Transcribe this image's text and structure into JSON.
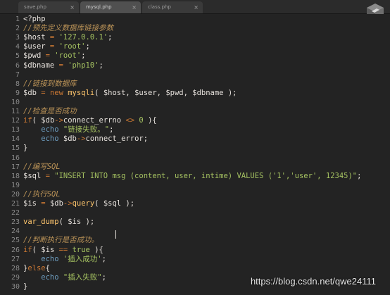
{
  "tabs": [
    {
      "label": "save.php"
    },
    {
      "label": "mysql.php"
    },
    {
      "label": "class.php"
    }
  ],
  "code_lines": [
    [
      [
        "<?php",
        "p"
      ]
    ],
    [
      [
        "//预先定义数据库链接参数",
        "c"
      ]
    ],
    [
      [
        "$host",
        "v"
      ],
      [
        " = ",
        "k"
      ],
      [
        "'127.0.0.1'",
        "s"
      ],
      [
        ";",
        "p"
      ]
    ],
    [
      [
        "$user",
        "v"
      ],
      [
        " = ",
        "k"
      ],
      [
        "'root'",
        "s"
      ],
      [
        ";",
        "p"
      ]
    ],
    [
      [
        "$pwd",
        "v"
      ],
      [
        " = ",
        "k"
      ],
      [
        "'root'",
        "s"
      ],
      [
        ";",
        "p"
      ]
    ],
    [
      [
        "$dbname",
        "v"
      ],
      [
        " = ",
        "k"
      ],
      [
        "'php10'",
        "s"
      ],
      [
        ";",
        "p"
      ]
    ],
    [],
    [
      [
        "//链接到数据库",
        "c"
      ]
    ],
    [
      [
        "$db",
        "v"
      ],
      [
        " = ",
        "k"
      ],
      [
        "new ",
        "k"
      ],
      [
        "mysqli",
        "f"
      ],
      [
        "( $host, $user, $pwd, $dbname );",
        "p"
      ]
    ],
    [],
    [
      [
        "//检查是否成功",
        "c"
      ]
    ],
    [
      [
        "if",
        "k"
      ],
      [
        "( $db",
        "p"
      ],
      [
        "->",
        "k"
      ],
      [
        "connect_errno ",
        "p"
      ],
      [
        "<>",
        "k"
      ],
      [
        " 0 ",
        "n"
      ],
      [
        "){",
        "p"
      ]
    ],
    [
      [
        "    echo ",
        "t"
      ],
      [
        "\"链接失败。\"",
        "s"
      ],
      [
        ";",
        "p"
      ]
    ],
    [
      [
        "    echo ",
        "t"
      ],
      [
        "$db",
        "p"
      ],
      [
        "->",
        "k"
      ],
      [
        "connect_error;",
        "p"
      ]
    ],
    [
      [
        "}",
        "p"
      ]
    ],
    [],
    [
      [
        "//编写SQL",
        "c"
      ]
    ],
    [
      [
        "$sql",
        "v"
      ],
      [
        " = ",
        "k"
      ],
      [
        "\"INSERT INTO msg (content, user, intime) VALUES ('1','user', 12345)\"",
        "s"
      ],
      [
        ";",
        "p"
      ]
    ],
    [],
    [
      [
        "//执行SQL",
        "c"
      ]
    ],
    [
      [
        "$is",
        "v"
      ],
      [
        " = ",
        "k"
      ],
      [
        "$db",
        "p"
      ],
      [
        "->",
        "k"
      ],
      [
        "query",
        "f"
      ],
      [
        "( $sql );",
        "p"
      ]
    ],
    [],
    [
      [
        "var_dump",
        "f"
      ],
      [
        "( $is );",
        "p"
      ]
    ],
    [],
    [
      [
        "//判断执行是否成功。",
        "c"
      ]
    ],
    [
      [
        "if",
        "k"
      ],
      [
        "( $is ",
        "p"
      ],
      [
        "==",
        "k"
      ],
      [
        " true ",
        "n"
      ],
      [
        "){",
        "p"
      ]
    ],
    [
      [
        "    echo ",
        "t"
      ],
      [
        "'插入成功'",
        "s"
      ],
      [
        ";",
        "p"
      ]
    ],
    [
      [
        "}",
        "p"
      ],
      [
        "else",
        "k"
      ],
      [
        "{",
        "p"
      ]
    ],
    [
      [
        "    echo ",
        "t"
      ],
      [
        "\"插入失败\"",
        "s"
      ],
      [
        ";",
        "p"
      ]
    ],
    [
      [
        "}",
        "p"
      ]
    ]
  ],
  "watermark": "https://blog.csdn.net/qwe24111",
  "colors": {
    "background": "#232323",
    "keyword": "#cc7833",
    "string": "#a5c261",
    "comment": "#bc9458",
    "function": "#ffc66d",
    "echo": "#6d9cbe"
  }
}
